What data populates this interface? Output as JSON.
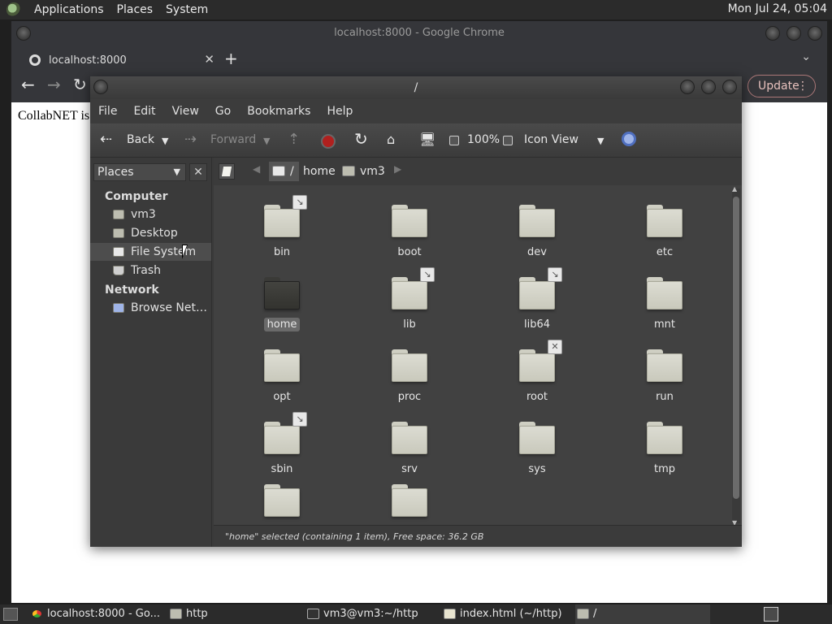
{
  "top_panel": {
    "menus": [
      "Applications",
      "Places",
      "System"
    ],
    "clock": "Mon Jul 24, 05:04"
  },
  "chrome": {
    "window_title": "localhost:8000 - Google Chrome",
    "tab_title": "localhost:8000",
    "update_label": "Update",
    "page_text": "CollabNET is"
  },
  "nautilus": {
    "window_title": "/",
    "menu": [
      "File",
      "Edit",
      "View",
      "Go",
      "Bookmarks",
      "Help"
    ],
    "toolbar": {
      "back": "Back",
      "forward": "Forward",
      "zoom": "100%",
      "view_mode": "Icon View"
    },
    "sidebar": {
      "selector": "Places",
      "sections": [
        {
          "title": "Computer",
          "items": [
            "vm3",
            "Desktop",
            "File System",
            "Trash"
          ]
        },
        {
          "title": "Network",
          "items": [
            "Browse Net…"
          ]
        }
      ],
      "selected": "File System"
    },
    "pathbar": [
      "/",
      "home",
      "vm3"
    ],
    "files": [
      {
        "name": "bin",
        "emblem": "link"
      },
      {
        "name": "boot",
        "emblem": ""
      },
      {
        "name": "dev",
        "emblem": ""
      },
      {
        "name": "etc",
        "emblem": ""
      },
      {
        "name": "home",
        "emblem": "",
        "selected": true
      },
      {
        "name": "lib",
        "emblem": "link"
      },
      {
        "name": "lib64",
        "emblem": "link"
      },
      {
        "name": "mnt",
        "emblem": ""
      },
      {
        "name": "opt",
        "emblem": ""
      },
      {
        "name": "proc",
        "emblem": ""
      },
      {
        "name": "root",
        "emblem": "noaccess"
      },
      {
        "name": "run",
        "emblem": ""
      },
      {
        "name": "sbin",
        "emblem": "link"
      },
      {
        "name": "srv",
        "emblem": ""
      },
      {
        "name": "sys",
        "emblem": ""
      },
      {
        "name": "tmp",
        "emblem": ""
      },
      {
        "name": "",
        "emblem": ""
      },
      {
        "name": "",
        "emblem": ""
      }
    ],
    "status": "\"home\" selected (containing 1 item), Free space: 36.2 GB"
  },
  "taskbar": {
    "tasks": [
      {
        "label": "localhost:8000 - Go...",
        "icon": "chrome-icon"
      },
      {
        "label": "http",
        "icon": "folder-icon"
      },
      {
        "label": "vm3@vm3:~/http",
        "icon": "terminal-icon"
      },
      {
        "label": "index.html (~/http) ...",
        "icon": "text-editor-icon"
      },
      {
        "label": "/",
        "icon": "folder-icon"
      }
    ]
  }
}
